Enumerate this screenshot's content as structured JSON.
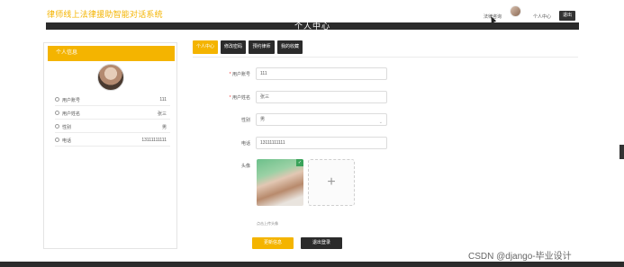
{
  "header": {
    "site_title": "律师线上法律援助智能对话系统",
    "link_online_chat": "法律咨询",
    "link_user_center": "个人中心",
    "logout_label": "退出"
  },
  "banner": {
    "title": "个人中心"
  },
  "profile_card": {
    "header_label": "个人信息",
    "rows": [
      {
        "label": "用户账号",
        "value": "111",
        "icon": "user-icon"
      },
      {
        "label": "用户姓名",
        "value": "张三",
        "icon": "user-icon"
      },
      {
        "label": "性别",
        "value": "男",
        "icon": "user-icon"
      },
      {
        "label": "电话",
        "value": "13111111111",
        "icon": "user-icon"
      }
    ]
  },
  "tabs": [
    {
      "label": "个人中心",
      "active": true
    },
    {
      "label": "修改密码",
      "active": false
    },
    {
      "label": "预约律师",
      "active": false
    },
    {
      "label": "我的收藏",
      "active": false
    }
  ],
  "form": {
    "account": {
      "label": "用户账号",
      "required": "*",
      "value": "111"
    },
    "name": {
      "label": "用户姓名",
      "required": "*",
      "value": "张三"
    },
    "gender": {
      "label": "性别",
      "value": "男"
    },
    "phone": {
      "label": "电话",
      "value": "13111111111"
    },
    "avatar": {
      "label": "头像",
      "hint": "点击上传头像"
    },
    "update_label": "更新信息",
    "logout_label": "退出登录"
  },
  "watermark": "CSDN @django-毕业设计",
  "colors": {
    "accent": "#f4b400",
    "dark": "#2b2b2b"
  }
}
